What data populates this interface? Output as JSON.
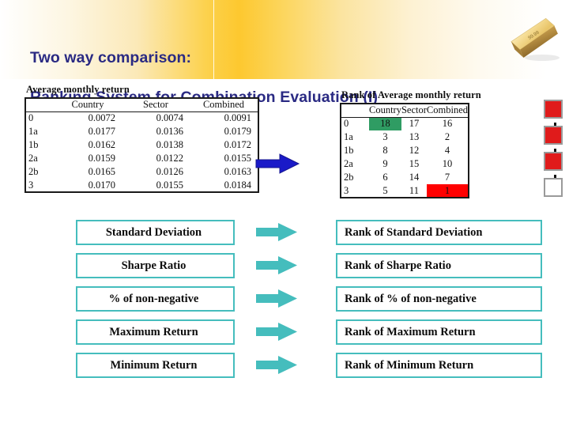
{
  "header": {
    "title": "Two way comparison:\nRanking System for Combination Evaluation (I)",
    "title_line_1": "Two way comparison:",
    "title_line_2": "Ranking System for Combination Evaluation (I)",
    "title_color": "#2a2a83",
    "band_gradient_accent": "#fcd24f",
    "gold_bar_label": "99.99"
  },
  "left_table": {
    "caption": "Average monthly return",
    "columns": [
      "",
      "Country",
      "Sector",
      "Combined"
    ],
    "rows": [
      {
        "label": "0",
        "country": "0.0072",
        "sector": "0.0074",
        "combined": "0.0091"
      },
      {
        "label": "1a",
        "country": "0.0177",
        "sector": "0.0136",
        "combined": "0.0179"
      },
      {
        "label": "1b",
        "country": "0.0162",
        "sector": "0.0138",
        "combined": "0.0172"
      },
      {
        "label": "2a",
        "country": "0.0159",
        "sector": "0.0122",
        "combined": "0.0155"
      },
      {
        "label": "2b",
        "country": "0.0165",
        "sector": "0.0126",
        "combined": "0.0163"
      },
      {
        "label": "3",
        "country": "0.0170",
        "sector": "0.0155",
        "combined": "0.0184"
      }
    ]
  },
  "right_table": {
    "caption": "Rank of Average monthly return",
    "columns": [
      "",
      "Country",
      "Sector",
      "Combined"
    ],
    "rows": [
      {
        "label": "0",
        "country": "18",
        "sector": "17",
        "combined": "16"
      },
      {
        "label": "1a",
        "country": "3",
        "sector": "13",
        "combined": "2"
      },
      {
        "label": "1b",
        "country": "8",
        "sector": "12",
        "combined": "4"
      },
      {
        "label": "2a",
        "country": "9",
        "sector": "15",
        "combined": "10"
      },
      {
        "label": "2b",
        "country": "6",
        "sector": "14",
        "combined": "7"
      },
      {
        "label": "3",
        "country": "5",
        "sector": "11",
        "combined": "1"
      }
    ],
    "highlights": {
      "green_cell": {
        "row": "0",
        "column": "Country",
        "value": "18",
        "color": "#2f9c63"
      },
      "red_cell": {
        "row": "3",
        "column": "Combined",
        "value": "1",
        "color": "#ff0000"
      }
    }
  },
  "middle_arrow": {
    "icon": "right-arrow-icon",
    "color": "#1a1ac8"
  },
  "flow_squares": {
    "arrow_color": "#111111",
    "items": [
      {
        "state": "red",
        "color": "#e01b1b"
      },
      {
        "state": "red",
        "color": "#e01b1b"
      },
      {
        "state": "red",
        "color": "#e01b1b"
      },
      {
        "state": "white",
        "color": "#ffffff"
      }
    ]
  },
  "metric_rows": {
    "arrow_icon": "right-arrow-icon",
    "arrow_color": "#45bdbd",
    "border_color": "#45bdbd",
    "items": [
      {
        "metric": "Standard Deviation",
        "rank": "Rank of Standard Deviation"
      },
      {
        "metric": "Sharpe Ratio",
        "rank": "Rank of Sharpe Ratio"
      },
      {
        "metric": "% of non-negative",
        "rank": "Rank of % of non-negative"
      },
      {
        "metric": "Maximum Return",
        "rank": "Rank of Maximum Return"
      },
      {
        "metric": "Minimum Return",
        "rank": "Rank of Minimum Return"
      }
    ]
  }
}
